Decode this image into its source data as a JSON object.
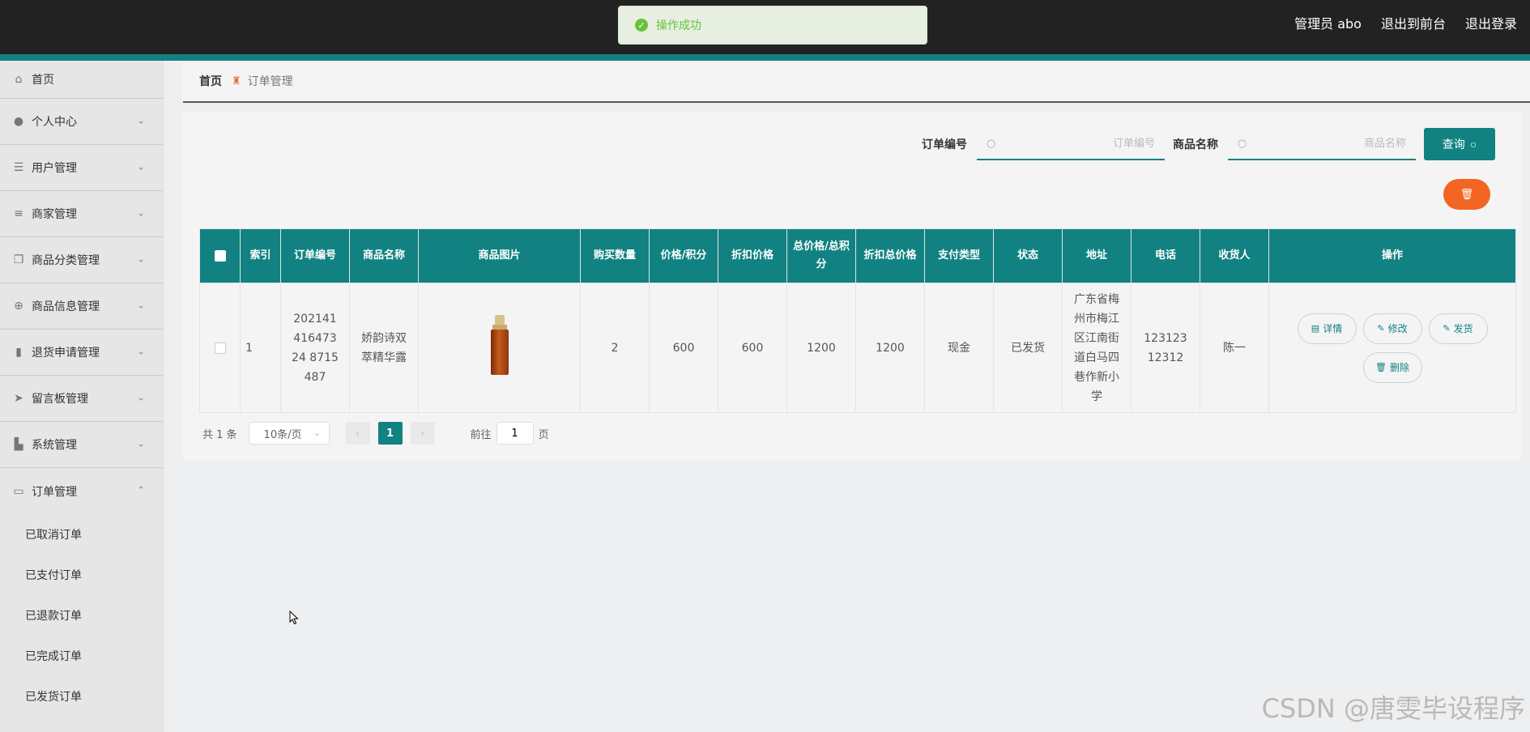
{
  "toast": {
    "text": "操作成功"
  },
  "header": {
    "user": "管理员 abo",
    "to_front": "退出到前台",
    "logout": "退出登录"
  },
  "sidebar": {
    "items": [
      {
        "label": "首页",
        "icon": "home-icon"
      },
      {
        "label": "个人中心",
        "icon": "user-icon"
      },
      {
        "label": "用户管理",
        "icon": "list-icon"
      },
      {
        "label": "商家管理",
        "icon": "menu-icon"
      },
      {
        "label": "商品分类管理",
        "icon": "copy-icon"
      },
      {
        "label": "商品信息管理",
        "icon": "target-icon"
      },
      {
        "label": "退货申请管理",
        "icon": "bar-chart-icon"
      },
      {
        "label": "留言板管理",
        "icon": "send-icon"
      },
      {
        "label": "系统管理",
        "icon": "tools-icon"
      },
      {
        "label": "订单管理",
        "icon": "briefcase-icon"
      }
    ],
    "submenu": [
      "已取消订单",
      "已支付订单",
      "已退款订单",
      "已完成订单",
      "已发货订单"
    ]
  },
  "breadcrumb": {
    "home": "首页",
    "current": "订单管理"
  },
  "search": {
    "order_label": "订单编号",
    "order_placeholder": "订单编号",
    "product_label": "商品名称",
    "product_placeholder": "商品名称",
    "query_button": "查询"
  },
  "table": {
    "columns": [
      "索引",
      "订单编号",
      "商品名称",
      "商品图片",
      "购买数量",
      "价格/积分",
      "折扣价格",
      "总价格/总积分",
      "折扣总价格",
      "支付类型",
      "状态",
      "地址",
      "电话",
      "收货人",
      "操作"
    ],
    "rows": [
      {
        "index": "1",
        "order_no": "20214141647324 8715487",
        "product_name": "娇韵诗双萃精华露",
        "quantity": "2",
        "price": "600",
        "discount_price": "600",
        "total_price": "1200",
        "discount_total": "1200",
        "pay_type": "现金",
        "status": "已发货",
        "address": "广东省梅州市梅江区江南街道白马四巷作新小学",
        "phone": "12312312312",
        "receiver": "陈一"
      }
    ],
    "actions": {
      "detail": "详情",
      "edit": "修改",
      "ship": "发货",
      "delete": "删除"
    }
  },
  "pagination": {
    "total": "共 1 条",
    "page_size": "10条/页",
    "current": "1",
    "goto_label": "前往",
    "goto_value": "1",
    "page_suffix": "页"
  },
  "watermark": "CSDN @唐雯毕设程序",
  "colors": {
    "accent": "#118281",
    "danger": "#f26522",
    "topbar": "#222222"
  }
}
